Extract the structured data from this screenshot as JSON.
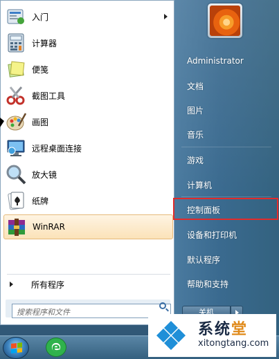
{
  "start_menu": {
    "programs": [
      {
        "label": "入门",
        "icon": "getting-started-icon",
        "has_submenu": true
      },
      {
        "label": "计算器",
        "icon": "calculator-icon"
      },
      {
        "label": "便笺",
        "icon": "sticky-notes-icon"
      },
      {
        "label": "截图工具",
        "icon": "snipping-tool-icon"
      },
      {
        "label": "画图",
        "icon": "paint-icon"
      },
      {
        "label": "远程桌面连接",
        "icon": "remote-desktop-icon"
      },
      {
        "label": "放大镜",
        "icon": "magnifier-icon"
      },
      {
        "label": "纸牌",
        "icon": "solitaire-icon"
      },
      {
        "label": "WinRAR",
        "icon": "winrar-icon",
        "highlighted": true
      }
    ],
    "all_programs_label": "所有程序",
    "search_placeholder": "搜索程序和文件"
  },
  "right_panel": {
    "user_name": "Administrator",
    "links": [
      "文档",
      "图片",
      "音乐",
      "游戏",
      "计算机",
      "控制面板",
      "设备和打印机",
      "默认程序",
      "帮助和支持"
    ],
    "highlighted_link": "控制面板",
    "shutdown_label": "关机"
  },
  "watermark": {
    "title_part1": "系统",
    "title_part2": "堂",
    "url": "xitongtang.com"
  },
  "colors": {
    "highlight_border": "#e12b2b",
    "hover_fill": "#fbe2b8",
    "panel_blue": "#3a6a8f"
  }
}
